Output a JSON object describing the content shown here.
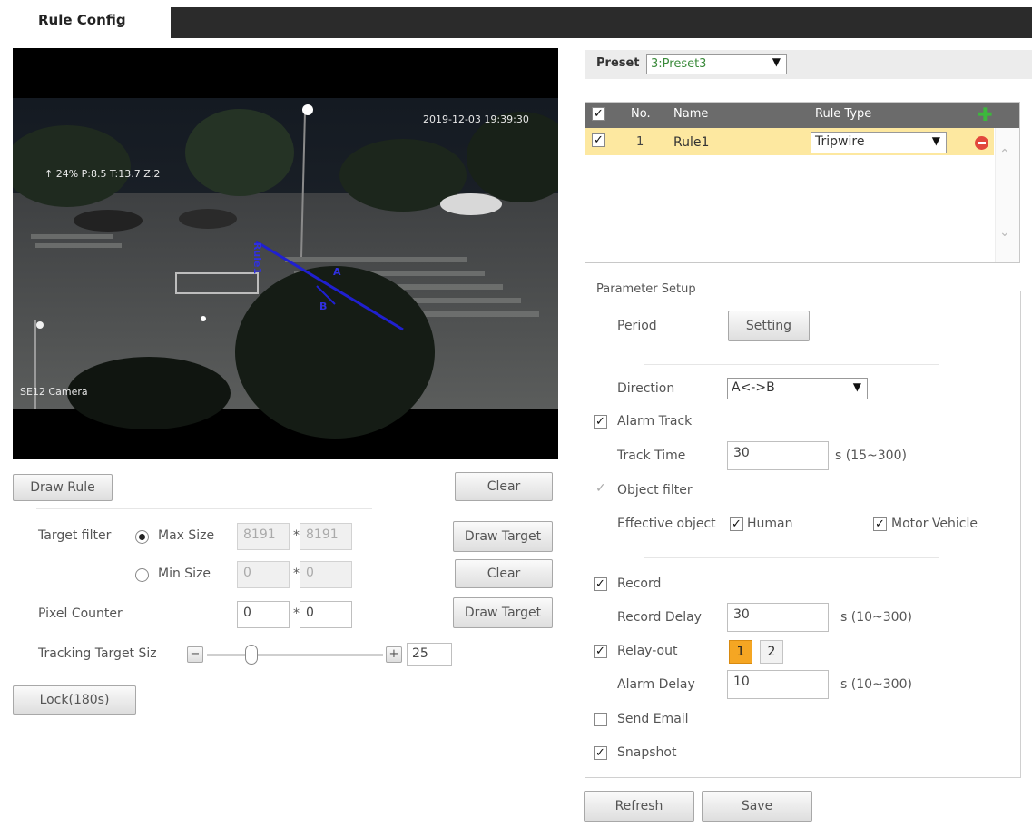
{
  "tab": {
    "title": "Rule Config"
  },
  "video": {
    "timestamp": "2019-12-03 19:39:30",
    "osd_info": "↑ 24% P:8.5 T:13.7 Z:2",
    "camera_label": "SE12 Camera",
    "rule_label": "Rule1",
    "side_a": "A",
    "side_b": "B"
  },
  "left_controls": {
    "draw_rule": "Draw Rule",
    "clear": "Clear",
    "target_filter_label": "Target filter",
    "max_size_label": "Max Size",
    "max_w": "8191",
    "max_h": "8191",
    "min_size_label": "Min Size",
    "min_w": "0",
    "min_h": "0",
    "times": "*",
    "draw_target": "Draw Target",
    "clear2": "Clear",
    "pixel_counter_label": "Pixel Counter",
    "pixel_w": "0",
    "pixel_h": "0",
    "draw_target2": "Draw Target",
    "tracking_label": "Tracking Target Siz",
    "tracking_value": "25",
    "tracking_fraction": 0.25,
    "minus": "−",
    "plus": "+",
    "lock": "Lock(180s)"
  },
  "preset": {
    "label": "Preset",
    "value": "3:Preset3"
  },
  "rule_table": {
    "headers": {
      "no": "No.",
      "name": "Name",
      "rule_type": "Rule Type"
    },
    "rows": [
      {
        "no": "1",
        "name": "Rule1",
        "rule_type": "Tripwire"
      }
    ]
  },
  "params": {
    "legend": "Parameter Setup",
    "period_label": "Period",
    "setting_btn": "Setting",
    "direction_label": "Direction",
    "direction_value": "A<->B",
    "alarm_track_label": "Alarm Track",
    "track_time_label": "Track Time",
    "track_time_value": "30",
    "track_time_range": "s (15~300)",
    "object_filter_label": "Object filter",
    "effective_object_label": "Effective object",
    "human_label": "Human",
    "motor_vehicle_label": "Motor Vehicle",
    "record_label": "Record",
    "record_delay_label": "Record Delay",
    "record_delay_value": "30",
    "record_delay_range": "s (10~300)",
    "relay_out_label": "Relay-out",
    "relay_1": "1",
    "relay_2": "2",
    "alarm_delay_label": "Alarm Delay",
    "alarm_delay_value": "10",
    "alarm_delay_range": "s (10~300)",
    "send_email_label": "Send Email",
    "snapshot_label": "Snapshot"
  },
  "bottom": {
    "refresh": "Refresh",
    "save": "Save"
  },
  "colors": {
    "accent_orange": "#f5a623",
    "selected_row": "#fde8a0",
    "header_bar": "#6b6b6b",
    "rule_line": "#2020d0"
  }
}
